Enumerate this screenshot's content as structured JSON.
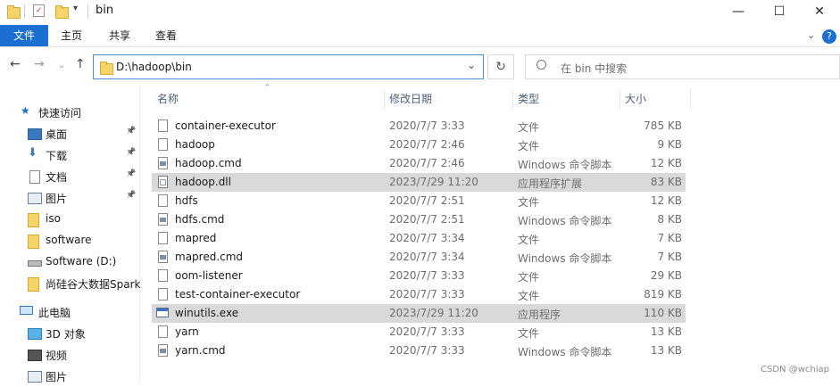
{
  "window": {
    "title": "bin",
    "controls": {
      "minimize": "—",
      "maximize": "☐",
      "close": "✕"
    }
  },
  "ribbon": {
    "tabs": [
      "文件",
      "主页",
      "共享",
      "查看"
    ],
    "expand_icon": "chevron-down",
    "help_icon": "?"
  },
  "address": {
    "path": "D:\\hadoop\\bin",
    "search_placeholder": "在 bin 中搜索"
  },
  "nav_pane": {
    "quick_access": "快速访问",
    "items": [
      {
        "label": "桌面",
        "icon": "desktop-icon",
        "pinned": true
      },
      {
        "label": "下载",
        "icon": "download-icon",
        "pinned": true
      },
      {
        "label": "文档",
        "icon": "document-icon",
        "pinned": true
      },
      {
        "label": "图片",
        "icon": "pictures-icon",
        "pinned": true
      },
      {
        "label": "iso",
        "icon": "folder-icon",
        "pinned": false
      },
      {
        "label": "software",
        "icon": "folder-icon",
        "pinned": false
      },
      {
        "label": "Software (D:)",
        "icon": "drive-icon",
        "pinned": false
      },
      {
        "label": "尚硅谷大数据Spark",
        "icon": "folder-icon",
        "pinned": false
      }
    ],
    "this_pc": "此电脑",
    "pc_items": [
      {
        "label": "3D 对象",
        "icon": "3d-objects-icon"
      },
      {
        "label": "视频",
        "icon": "videos-icon"
      },
      {
        "label": "图片",
        "icon": "pictures-icon"
      }
    ]
  },
  "columns": {
    "name": "名称",
    "date": "修改日期",
    "type": "类型",
    "size": "大小"
  },
  "files": [
    {
      "name": "container-executor",
      "date": "2020/7/7 3:33",
      "type": "文件",
      "size": "785 KB",
      "icon": "file",
      "selected": false
    },
    {
      "name": "hadoop",
      "date": "2020/7/7 2:46",
      "type": "文件",
      "size": "9 KB",
      "icon": "file",
      "selected": false
    },
    {
      "name": "hadoop.cmd",
      "date": "2020/7/7 2:46",
      "type": "Windows 命令脚本",
      "size": "12 KB",
      "icon": "cmd",
      "selected": false
    },
    {
      "name": "hadoop.dll",
      "date": "2023/7/29 11:20",
      "type": "应用程序扩展",
      "size": "83 KB",
      "icon": "dll",
      "selected": true
    },
    {
      "name": "hdfs",
      "date": "2020/7/7 2:51",
      "type": "文件",
      "size": "12 KB",
      "icon": "file",
      "selected": false
    },
    {
      "name": "hdfs.cmd",
      "date": "2020/7/7 2:51",
      "type": "Windows 命令脚本",
      "size": "8 KB",
      "icon": "cmd",
      "selected": false
    },
    {
      "name": "mapred",
      "date": "2020/7/7 3:34",
      "type": "文件",
      "size": "7 KB",
      "icon": "file",
      "selected": false
    },
    {
      "name": "mapred.cmd",
      "date": "2020/7/7 3:34",
      "type": "Windows 命令脚本",
      "size": "7 KB",
      "icon": "cmd",
      "selected": false
    },
    {
      "name": "oom-listener",
      "date": "2020/7/7 3:33",
      "type": "文件",
      "size": "29 KB",
      "icon": "file",
      "selected": false
    },
    {
      "name": "test-container-executor",
      "date": "2020/7/7 3:33",
      "type": "文件",
      "size": "819 KB",
      "icon": "file",
      "selected": false
    },
    {
      "name": "winutils.exe",
      "date": "2023/7/29 11:20",
      "type": "应用程序",
      "size": "110 KB",
      "icon": "exe",
      "selected": true
    },
    {
      "name": "yarn",
      "date": "2020/7/7 3:33",
      "type": "文件",
      "size": "13 KB",
      "icon": "file",
      "selected": false
    },
    {
      "name": "yarn.cmd",
      "date": "2020/7/7 3:33",
      "type": "Windows 命令脚本",
      "size": "13 KB",
      "icon": "cmd",
      "selected": false
    }
  ],
  "watermark": "CSDN @wchiap",
  "colors": {
    "accent": "#1a6fd1",
    "selected_row": "#d9d9d9",
    "folder": "#f6d46b"
  }
}
